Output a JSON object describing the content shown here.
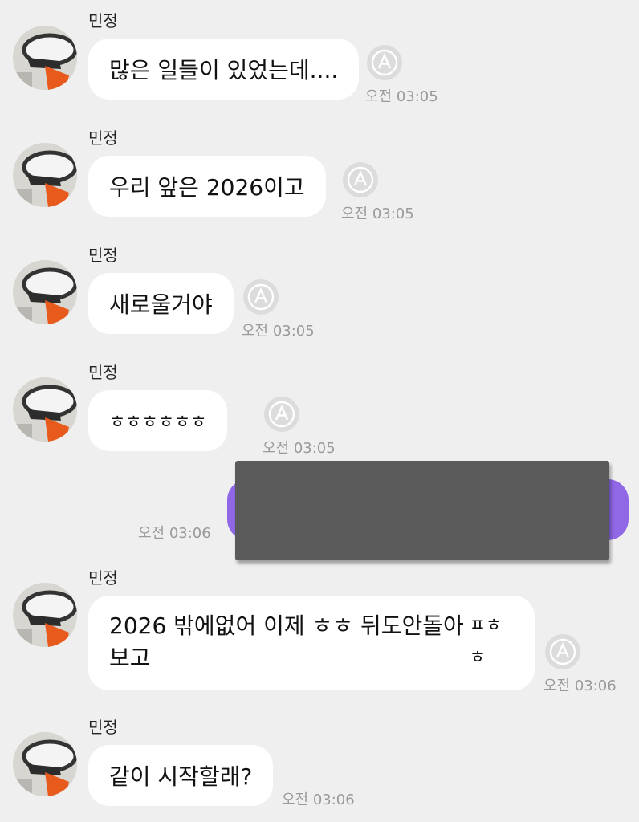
{
  "sender_name": "민정",
  "messages": [
    {
      "text": "많은 일들이 있었는데....",
      "time": "오전 03:05"
    },
    {
      "text": "우리 앞은 2026이고",
      "time": "오전 03:05"
    },
    {
      "text": "새로울거야",
      "time": "오전 03:05"
    },
    {
      "text": "ㅎㅎㅎㅎㅎㅎ",
      "time": "오전 03:05"
    },
    {
      "outgoing": true,
      "redacted": true,
      "time": "오전 03:06"
    },
    {
      "line1": "2026 밖에없어 이제 ㅎㅎ 뒤도안돌아보고",
      "line2": "ㅍㅎㅎ",
      "time": "오전 03:06"
    },
    {
      "text": "같이 시작할래?",
      "time": "오전 03:06"
    }
  ],
  "icons": {
    "translate": "auto-translate-icon",
    "avatar": "profile-avatar"
  },
  "colors": {
    "background": "#efefef",
    "incoming_bubble": "#ffffff",
    "outgoing_bubble": "#9068e6",
    "timestamp": "#9a9a9a",
    "redaction": "#5a5a5a"
  }
}
